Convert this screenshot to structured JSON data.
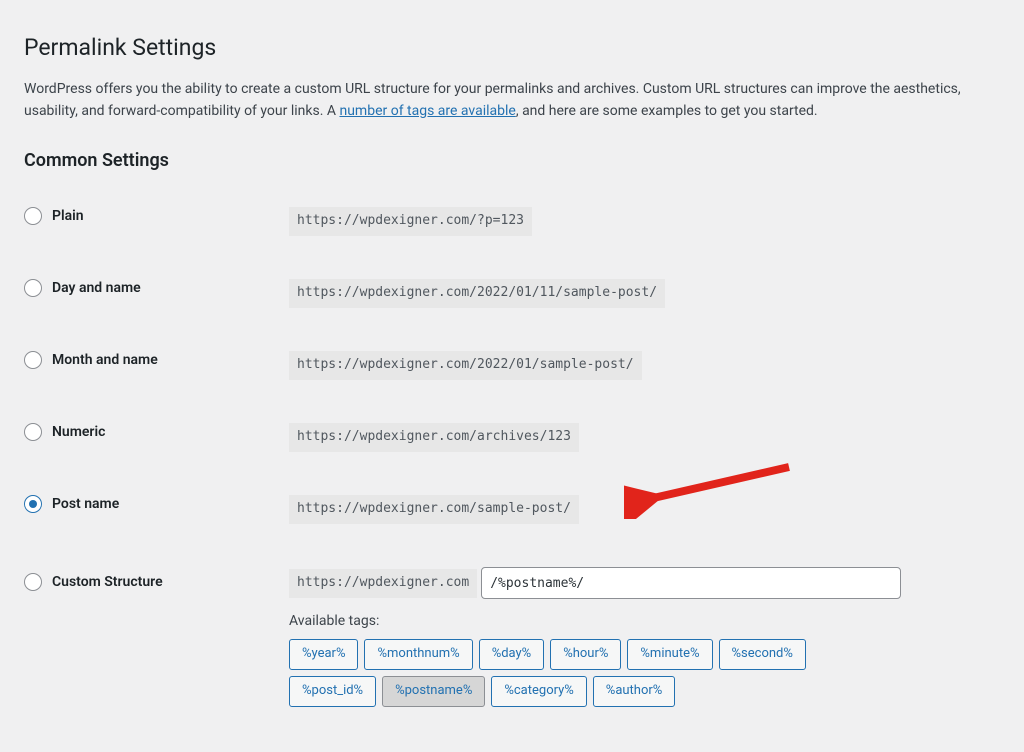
{
  "title": "Permalink Settings",
  "intro_before_link": "WordPress offers you the ability to create a custom URL structure for your permalinks and archives. Custom URL structures can improve the aesthetics, usability, and forward-compatibility of your links. A ",
  "intro_link_text": "number of tags are available",
  "intro_after_link": ", and here are some examples to get you started.",
  "section_common": "Common Settings",
  "options": {
    "plain": {
      "label": "Plain",
      "url": "https://wpdexigner.com/?p=123"
    },
    "dayname": {
      "label": "Day and name",
      "url": "https://wpdexigner.com/2022/01/11/sample-post/"
    },
    "month": {
      "label": "Month and name",
      "url": "https://wpdexigner.com/2022/01/sample-post/"
    },
    "numeric": {
      "label": "Numeric",
      "url": "https://wpdexigner.com/archives/123"
    },
    "postname": {
      "label": "Post name",
      "url": "https://wpdexigner.com/sample-post/"
    },
    "custom": {
      "label": "Custom Structure",
      "prefix": "https://wpdexigner.com",
      "value": "/%postname%/"
    }
  },
  "available_tags_label": "Available tags:",
  "tags_row1": [
    "%year%",
    "%monthnum%",
    "%day%",
    "%hour%",
    "%minute%",
    "%second%"
  ],
  "tags_row2": [
    "%post_id%",
    "%postname%",
    "%category%",
    "%author%"
  ],
  "active_tag": "%postname%"
}
